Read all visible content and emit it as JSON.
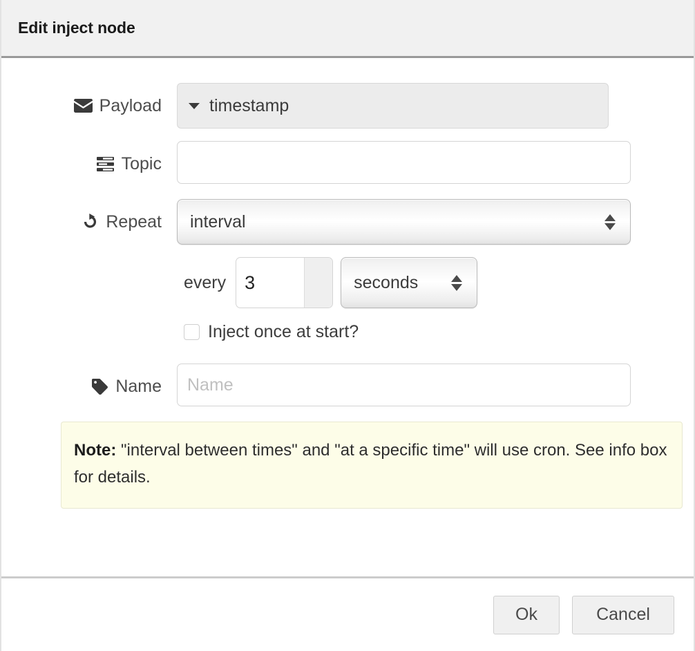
{
  "dialog": {
    "title": "Edit inject node"
  },
  "form": {
    "payload": {
      "label": "Payload",
      "icon": "envelope-icon",
      "value": "timestamp"
    },
    "topic": {
      "label": "Topic",
      "icon": "tasks-list-icon",
      "value": "",
      "placeholder": ""
    },
    "repeat": {
      "label": "Repeat",
      "icon": "repeat-refresh-icon",
      "value": "interval"
    },
    "interval": {
      "every_label": "every",
      "count_value": "3",
      "unit_value": "seconds"
    },
    "inject_once": {
      "label": "Inject once at start?",
      "checked": false
    },
    "name": {
      "label": "Name",
      "icon": "tag-icon",
      "value": "",
      "placeholder": "Name"
    }
  },
  "note": {
    "prefix": "Note:",
    "text": " \"interval between times\" and \"at a specific time\" will use cron. See info box for details."
  },
  "footer": {
    "ok_label": "Ok",
    "cancel_label": "Cancel"
  },
  "colors": {
    "header_bg": "#f1f1f1",
    "note_bg": "#fdfde8",
    "button_bg": "#f0f0f0",
    "text": "#333333"
  }
}
